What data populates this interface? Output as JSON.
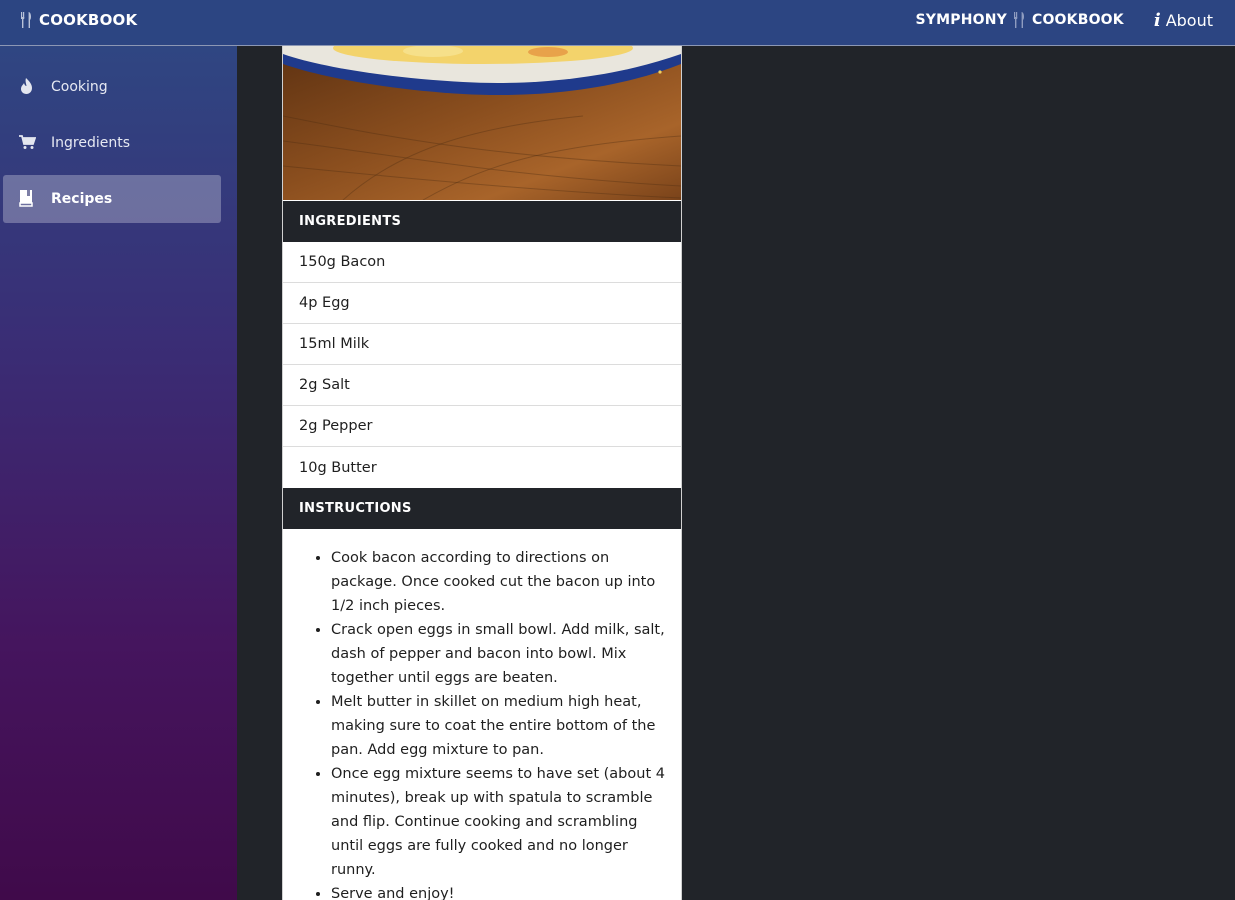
{
  "app": {
    "brand": "COOKBOOK",
    "right_brand_prefix": "SYMPHONY",
    "right_brand_suffix": "COOKBOOK",
    "about_label": "About"
  },
  "sidebar": {
    "items": [
      {
        "label": "Cooking",
        "icon": "flame-icon",
        "active": false
      },
      {
        "label": "Ingredients",
        "icon": "cart-icon",
        "active": false
      },
      {
        "label": "Recipes",
        "icon": "book-icon",
        "active": true
      }
    ]
  },
  "recipe": {
    "ingredients_heading": "INGREDIENTS",
    "ingredients": [
      "150g Bacon",
      "4p Egg",
      "15ml Milk",
      "2g Salt",
      "2g Pepper",
      "10g Butter"
    ],
    "instructions_heading": "INSTRUCTIONS",
    "instructions": [
      "Cook bacon according to directions on package. Once cooked cut the bacon up into 1/2 inch pieces.",
      "Crack open eggs in small bowl. Add milk, salt, dash of pepper and bacon into bowl. Mix together until eggs are beaten.",
      "Melt butter in skillet on medium high heat, making sure to coat the entire bottom of the pan. Add egg mixture to pan.",
      "Once egg mixture seems to have set (about 4 minutes), break up with spatula to scramble and flip. Continue cooking and scrambling until eggs are fully cooked and no longer runny.",
      "Serve and enjoy!"
    ]
  },
  "colors": {
    "topbar": "#2c4582",
    "header_dark": "#212429",
    "sidebar_top": "#2f4682",
    "sidebar_bottom": "#400a4a"
  }
}
